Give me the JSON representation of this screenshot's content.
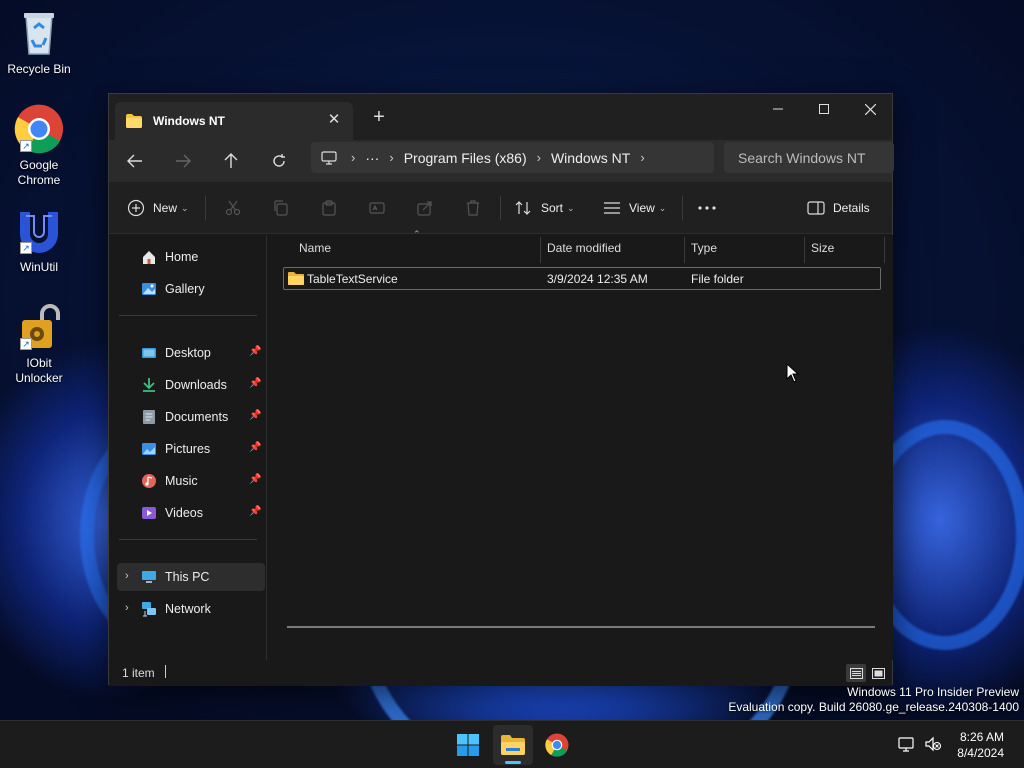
{
  "desktop": {
    "icons": [
      {
        "label": "Recycle Bin"
      },
      {
        "label": "Google Chrome"
      },
      {
        "label": "WinUtil"
      },
      {
        "label": "IObit Unlocker"
      }
    ]
  },
  "window": {
    "tab_title": "Windows NT",
    "address": {
      "overflow": "···",
      "segments": [
        "Program Files (x86)",
        "Windows NT"
      ]
    },
    "search_placeholder": "Search Windows NT",
    "toolbar": {
      "new_label": "New",
      "sort_label": "Sort",
      "view_label": "View",
      "details_label": "Details"
    },
    "sidebar": {
      "home": "Home",
      "gallery": "Gallery",
      "quick_access": [
        {
          "label": "Desktop"
        },
        {
          "label": "Downloads"
        },
        {
          "label": "Documents"
        },
        {
          "label": "Pictures"
        },
        {
          "label": "Music"
        },
        {
          "label": "Videos"
        }
      ],
      "this_pc": "This PC",
      "network": "Network"
    },
    "columns": {
      "name": "Name",
      "date_modified": "Date modified",
      "type": "Type",
      "size": "Size"
    },
    "files": [
      {
        "name": "TableTextService",
        "date_modified": "3/9/2024 12:35 AM",
        "type": "File folder",
        "size": ""
      }
    ],
    "status": {
      "item_count": "1 item"
    }
  },
  "watermark": {
    "line1": "Windows 11 Pro Insider Preview",
    "line2": "Evaluation copy. Build 26080.ge_release.240308-1400"
  },
  "taskbar": {
    "time": "8:26 AM",
    "date": "8/4/2024"
  },
  "colors": {
    "accent": "#4cc2ff",
    "folder": "#f4c542",
    "window_bg": "#191919"
  }
}
